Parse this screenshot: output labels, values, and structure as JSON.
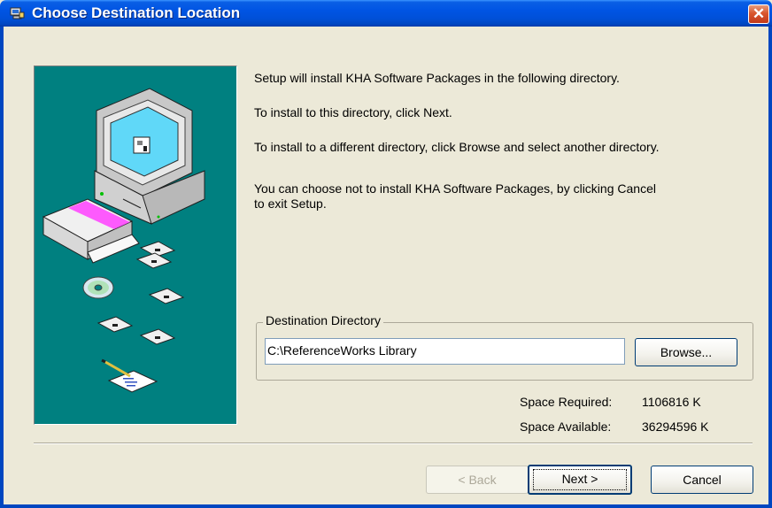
{
  "window": {
    "title": "Choose Destination Location",
    "close_glyph": "✕"
  },
  "messages": [
    "Setup will install KHA Software Packages in the following directory.",
    "To install to this directory, click Next.",
    "To install to a different directory, click Browse and select another directory.",
    "You can choose not to install KHA Software Packages, by clicking Cancel",
    "to exit Setup."
  ],
  "destination": {
    "group_label": "Destination Directory",
    "path": "C:\\ReferenceWorks Library",
    "browse_label": "Browse..."
  },
  "space": {
    "required_label": "Space Required:",
    "required_value": "1106816 K",
    "available_label": "Space Available:",
    "available_value": "36294596 K"
  },
  "buttons": {
    "back": "< Back",
    "next": "Next >",
    "cancel": "Cancel"
  },
  "colors": {
    "panel_teal": "#008080",
    "title_blue": "#0054E3",
    "dialog_bg": "#ECE9D8"
  },
  "icons": {
    "title": "setup-computer-icon",
    "illustration": "computer-install-illustration"
  }
}
